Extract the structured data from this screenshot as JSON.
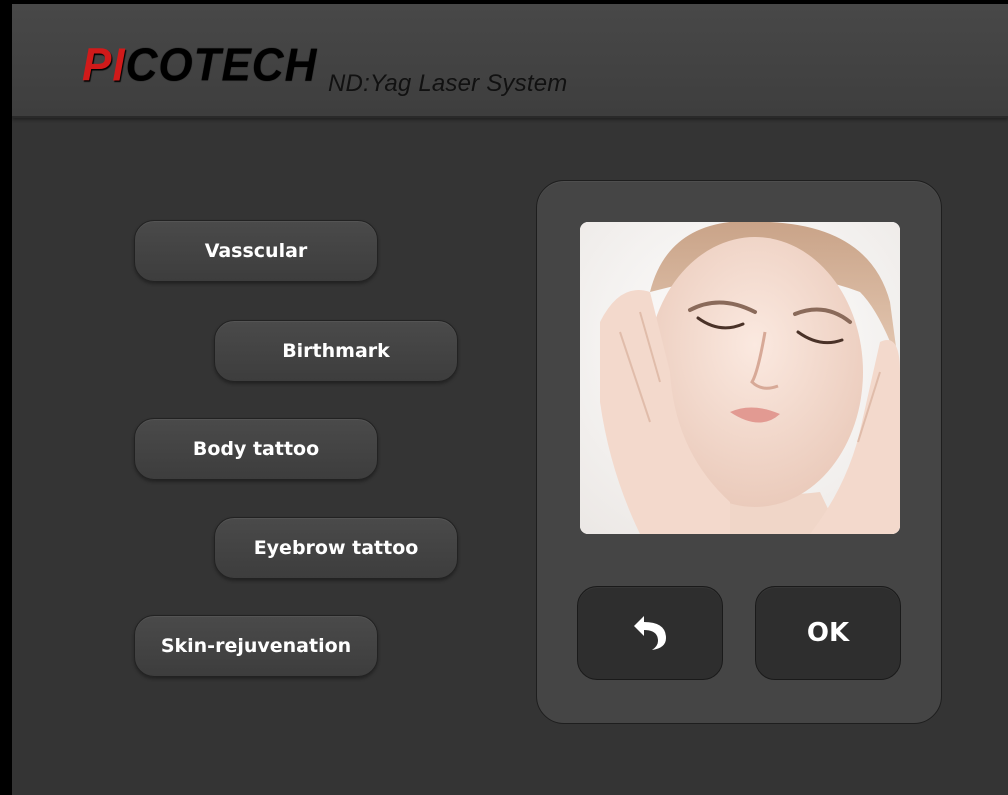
{
  "header": {
    "brand_prefix": "PI",
    "brand_suffix": "COTECH",
    "tagline": "ND:Yag Laser System",
    "brand_prefix_color": "#d11a1a"
  },
  "menu": {
    "items": [
      {
        "label": "Vasscular"
      },
      {
        "label": "Birthmark"
      },
      {
        "label": "Body tattoo"
      },
      {
        "label": "Eyebrow tattoo"
      },
      {
        "label": "Skin-rejuvenation"
      }
    ]
  },
  "preview": {
    "image_subject": "face-photo",
    "back_icon": "undo-arrow-icon",
    "ok_label": "OK"
  }
}
